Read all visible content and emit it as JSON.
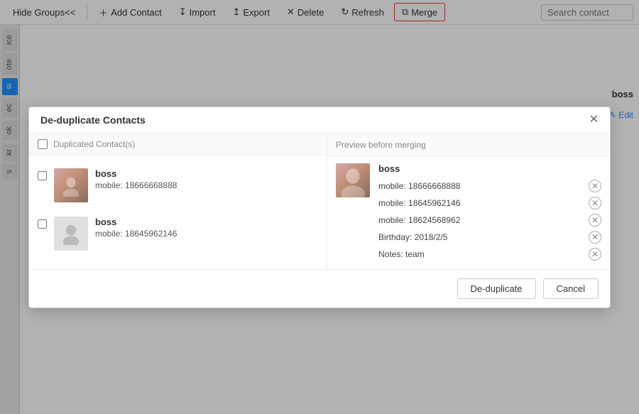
{
  "toolbar": {
    "hide_groups_label": "Hide Groups<<",
    "add_contact_label": "Add Contact",
    "import_label": "Import",
    "export_label": "Export",
    "delete_label": "Delete",
    "refresh_label": "Refresh",
    "merge_label": "Merge",
    "search_placeholder": "Search contact"
  },
  "dialog": {
    "title": "De-duplicate Contacts",
    "left_header": "Duplicated Contact(s)",
    "right_header": "Preview before merging",
    "contacts": [
      {
        "name": "boss",
        "detail": "mobile: 18666668888",
        "has_photo": true
      },
      {
        "name": "boss",
        "detail": "mobile: 18645962146",
        "has_photo": false
      }
    ],
    "preview": {
      "name": "boss",
      "fields": [
        "mobile: 18666668888",
        "mobile: 18645962146",
        "mobile: 18624568962",
        "Birthday: 2018/2/5",
        "Notes: team"
      ]
    },
    "footer": {
      "dedup_label": "De-duplicate",
      "cancel_label": "Cancel"
    }
  },
  "background": {
    "contact_name": "boss",
    "edit_label": "✎ Edit"
  }
}
